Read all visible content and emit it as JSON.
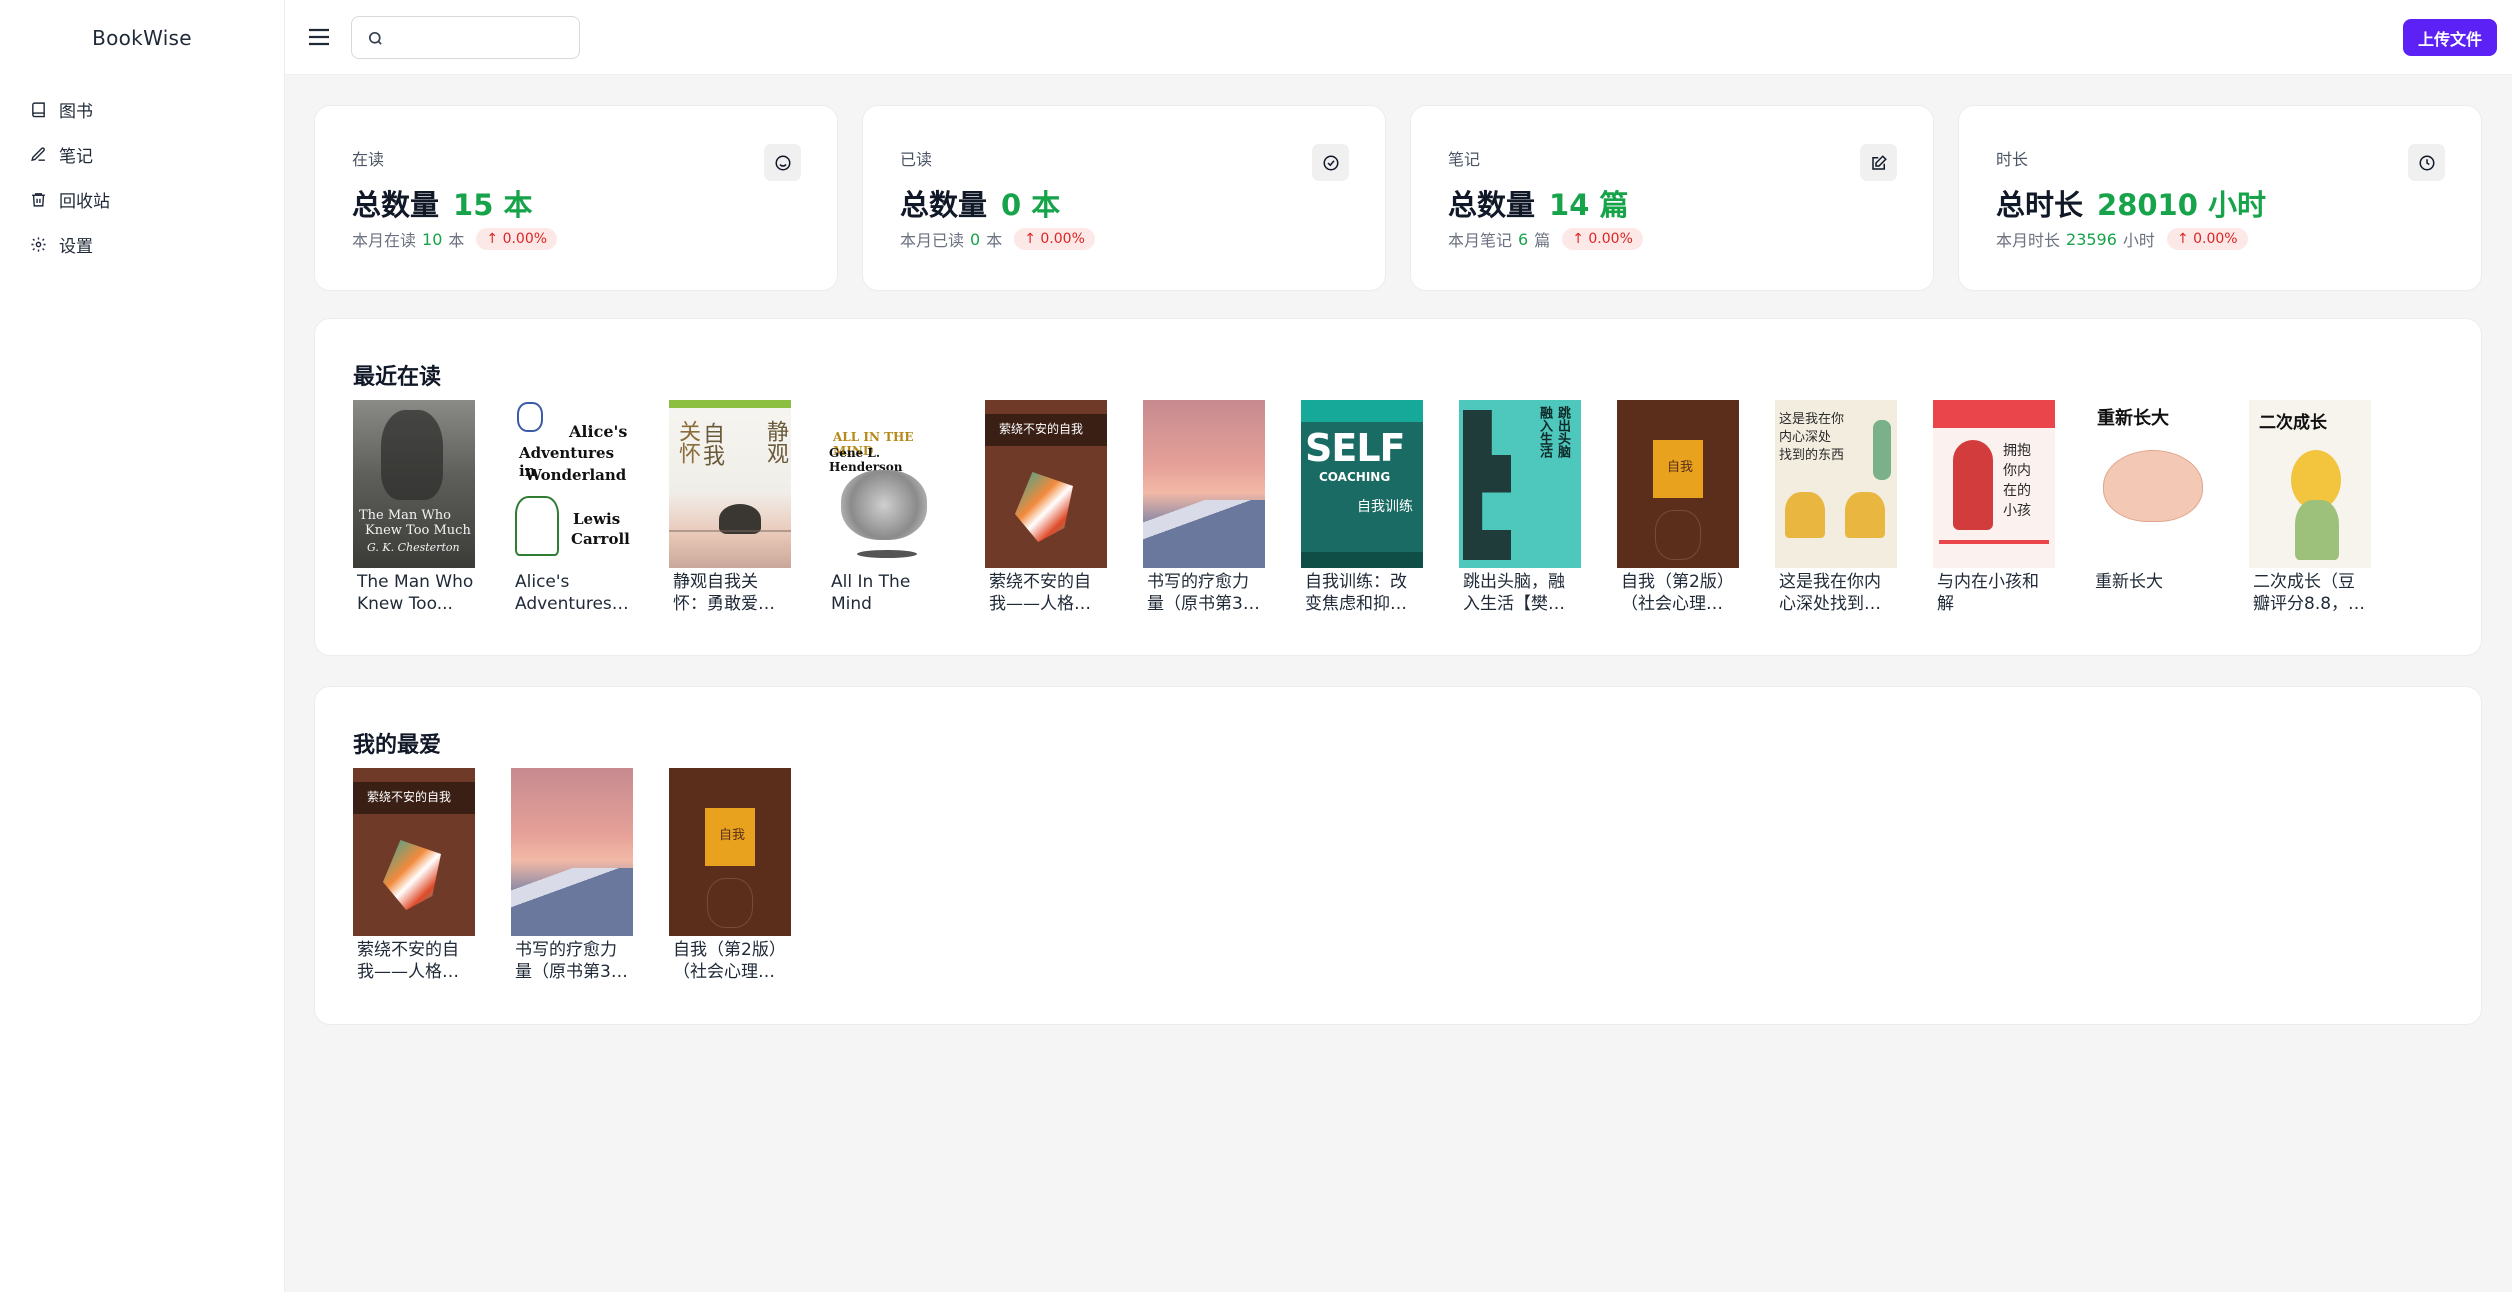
{
  "app": {
    "brand": "BookWise"
  },
  "sidebar": {
    "items": [
      {
        "label": "图书",
        "icon": "book-icon"
      },
      {
        "label": "笔记",
        "icon": "pen-icon"
      },
      {
        "label": "回收站",
        "icon": "trash-icon"
      },
      {
        "label": "设置",
        "icon": "gear-icon"
      }
    ]
  },
  "header": {
    "search_value": "",
    "upload_label": "上传文件"
  },
  "stats": [
    {
      "label": "在读",
      "main_label": "总数量",
      "value": "15 本",
      "sub_label": "本月在读",
      "sub_value": "10",
      "sub_unit": "本",
      "change": "↑ 0.00%",
      "icon": "smile-icon"
    },
    {
      "label": "已读",
      "main_label": "总数量",
      "value": "0 本",
      "sub_label": "本月已读",
      "sub_value": "0",
      "sub_unit": "本",
      "change": "↑ 0.00%",
      "icon": "check-circle-icon"
    },
    {
      "label": "笔记",
      "main_label": "总数量",
      "value": "14 篇",
      "sub_label": "本月笔记",
      "sub_value": "6",
      "sub_unit": "篇",
      "change": "↑ 0.00%",
      "icon": "edit-note-icon"
    },
    {
      "label": "时长",
      "main_label": "总时长",
      "value": "28010 小时",
      "sub_label": "本月时长",
      "sub_value": "23596",
      "sub_unit": "小时",
      "change": "↑ 0.00%",
      "icon": "clock-icon"
    }
  ],
  "recent": {
    "title": "最近在读",
    "books": [
      {
        "title": "The Man Who Knew Too...",
        "cover_text": [
          "The Man Who",
          "Knew Too Much",
          "G. K. Chesterton"
        ]
      },
      {
        "title": "Alice's Adventures i...",
        "cover_text": [
          "Alice's",
          "Adventures in",
          "Wonderland",
          "Lewis",
          "Carroll"
        ]
      },
      {
        "title": "静观自我关怀：勇敢爱自己的...",
        "cover_text": [
          "关怀",
          "自我",
          "静观"
        ]
      },
      {
        "title": "All In The Mind",
        "cover_text": [
          "ALL IN THE MIND",
          "Gene L. Henderson"
        ]
      },
      {
        "title": "萦绕不安的自我——人格结构...",
        "cover_text": [
          "萦绕不安的自我"
        ]
      },
      {
        "title": "书写的疗愈力量（原书第3版）",
        "cover_text": []
      },
      {
        "title": "自我训练：改变焦虑和抑郁的...",
        "cover_text": [
          "SELF",
          "COACHING",
          "自我训练"
        ]
      },
      {
        "title": "跳出头脑，融入生活【樊登推...",
        "cover_text": [
          "跳出头脑",
          "融入生活"
        ]
      },
      {
        "title": "自我（第2版）（社会心理学...",
        "cover_text": [
          "自我"
        ]
      },
      {
        "title": "这是我在你内心深处找到的东...",
        "cover_text": [
          "这是我在你",
          "内心深处",
          "找到的东西"
        ]
      },
      {
        "title": "与内在小孩和解",
        "cover_text": [
          "拥抱",
          "你内",
          "在的",
          "小孩"
        ]
      },
      {
        "title": "重新长大",
        "cover_text": [
          "重新长大"
        ]
      },
      {
        "title": "二次成长（豆瓣评分8.8，B站...",
        "cover_text": [
          "二次成长"
        ]
      }
    ]
  },
  "favorites": {
    "title": "我的最爱",
    "books": [
      {
        "title": "萦绕不安的自我——人格结构...",
        "cover_text": [
          "萦绕不安的自我"
        ]
      },
      {
        "title": "书写的疗愈力量（原书第3版）",
        "cover_text": []
      },
      {
        "title": "自我（第2版）（社会心理学...",
        "cover_text": [
          "自我"
        ]
      }
    ]
  },
  "colors": {
    "accent": "#5b21f5",
    "positive": "#16a34a",
    "negative": "#dc2626"
  }
}
